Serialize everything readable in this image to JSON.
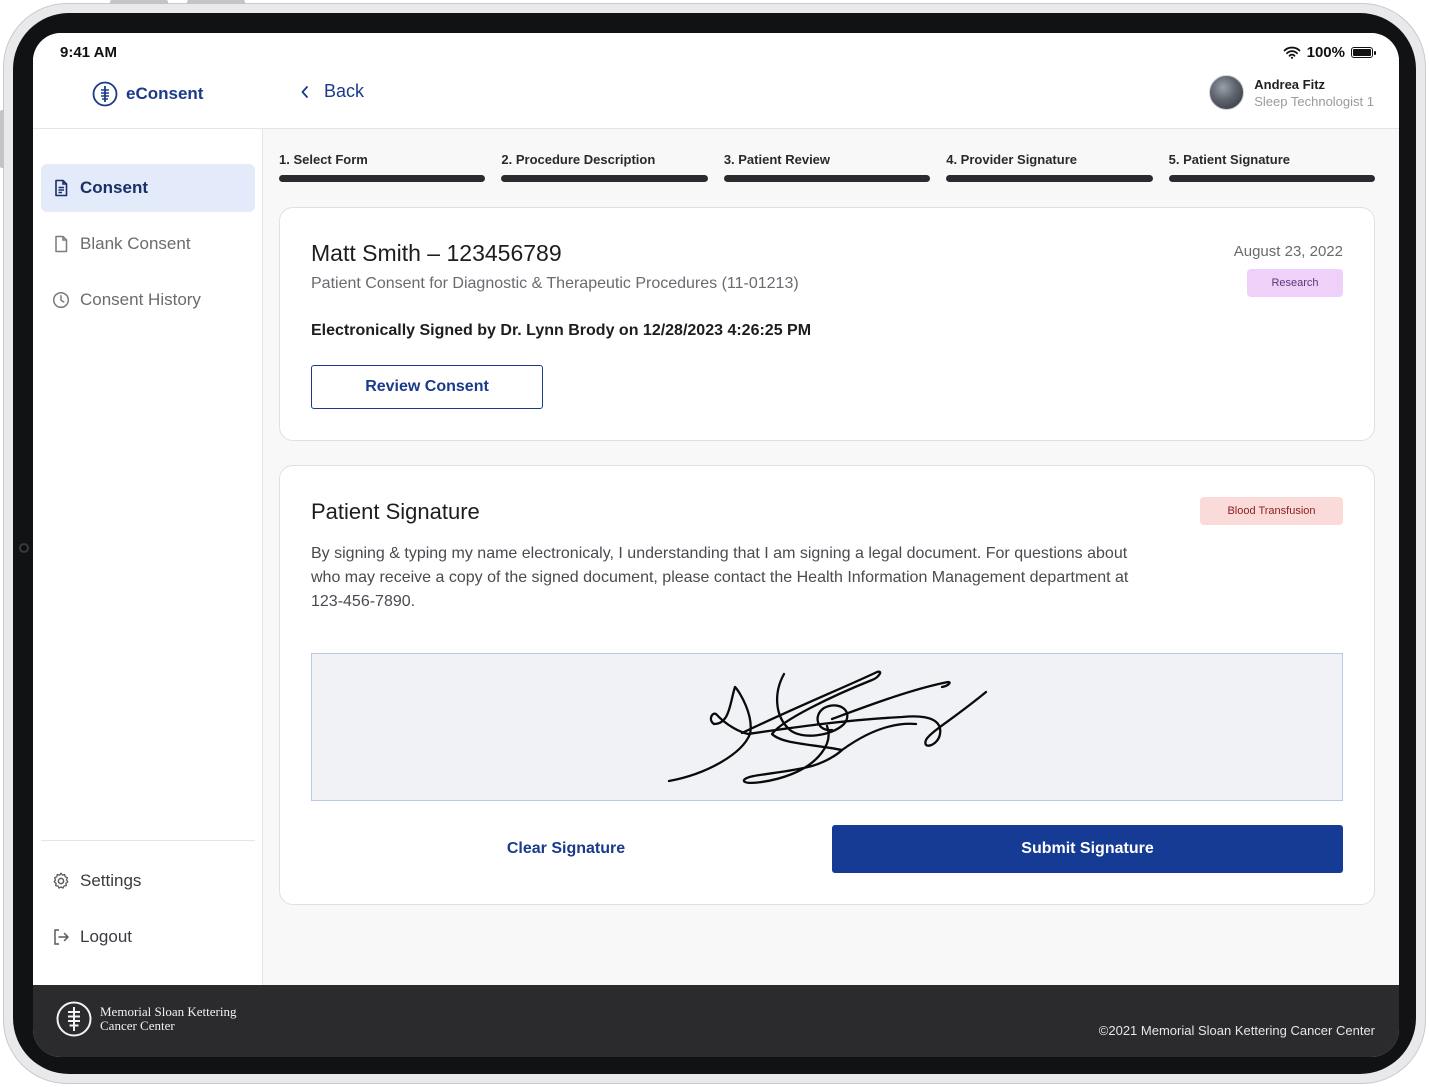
{
  "status_bar": {
    "time": "9:41 AM",
    "battery": "100%"
  },
  "app": {
    "name": "eConsent"
  },
  "sidebar": {
    "items": [
      {
        "label": "Consent",
        "icon": "document-icon",
        "active": true
      },
      {
        "label": "Blank Consent",
        "icon": "blank-document-icon",
        "active": false
      },
      {
        "label": "Consent History",
        "icon": "clock-icon",
        "active": false
      }
    ],
    "bottom_items": [
      {
        "label": "Settings",
        "icon": "gear-icon"
      },
      {
        "label": "Logout",
        "icon": "logout-icon"
      }
    ]
  },
  "header": {
    "back_label": "Back",
    "user": {
      "name": "Andrea Fitz",
      "role": "Sleep Technologist 1"
    }
  },
  "steps": [
    {
      "label": "1. Select Form"
    },
    {
      "label": "2. Procedure Description"
    },
    {
      "label": "3. Patient Review"
    },
    {
      "label": "4. Provider Signature"
    },
    {
      "label": "5. Patient Signature"
    }
  ],
  "consent_card": {
    "patient": "Matt Smith – 123456789",
    "form": "Patient Consent for Diagnostic & Therapeutic Procedures (11-01213)",
    "date": "August 23, 2022",
    "badge": "Research",
    "signed_line": "Electronically Signed by Dr. Lynn Brody on 12/28/2023 4:26:25 PM",
    "review_button": "Review Consent"
  },
  "signature_card": {
    "title": "Patient Signature",
    "badge": "Blood Transfusion",
    "description": "By signing & typing my name electronicaly, I understanding that I am signing a legal document. For questions about who may receive a copy of the signed document, please contact the Health Information Management department at 123-456-7890.",
    "clear_button": "Clear Signature",
    "submit_button": "Submit Signature"
  },
  "footer": {
    "logo_line1": "Memorial Sloan Kettering",
    "logo_line2": "Cancer Center",
    "copyright": "©2021 Memorial Sloan Kettering Cancer Center"
  },
  "colors": {
    "primary": "#163b94",
    "active_nav_bg": "#e3ebfb",
    "research_badge_bg": "#efd0f8",
    "blood_badge_bg": "#fbdada",
    "footer_bg": "#2b2b2d"
  }
}
